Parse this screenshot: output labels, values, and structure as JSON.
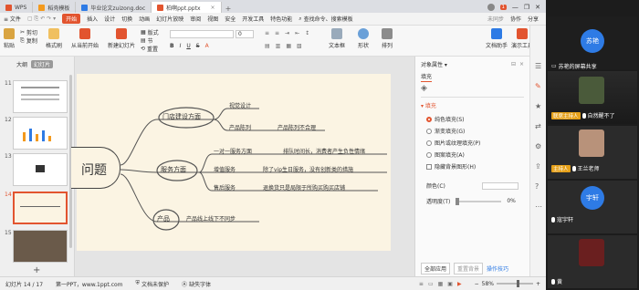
{
  "tabs": [
    {
      "label": "WPS",
      "active": false
    },
    {
      "label": "稻壳模板",
      "active": false
    },
    {
      "label": "毕业论文zuizong.doc",
      "active": false
    },
    {
      "label": "柏啊ppt.pptx",
      "active": true
    }
  ],
  "window": {
    "badge": "1"
  },
  "menu": [
    "≡ 文件",
    "开始",
    "插入",
    "设计",
    "切换",
    "动画",
    "幻灯片放映",
    "审阅",
    "视图",
    "安全",
    "开发工具",
    "特色功能",
    "查找命令、搜索模板",
    "未同步",
    "协作",
    "分享"
  ],
  "menu_active": "开始",
  "ribbon": {
    "paste": "粘贴",
    "cut": "剪切",
    "copy": "复制",
    "format_painter": "格式刷",
    "from_start": "从当前开始",
    "new_slide": "新建幻灯片",
    "layout": "版式",
    "section": "节",
    "reset": "重置",
    "bold": "B",
    "italic": "I",
    "underline": "U",
    "strike": "S",
    "font_size": "0",
    "text_box": "文本框",
    "shape": "形状",
    "arrange": "排列",
    "textbox_label": "文字",
    "find": "文档助手",
    "replace": "演示工具"
  },
  "side_tabs": [
    "大纲",
    "幻灯片"
  ],
  "slides": [
    {
      "num": "11"
    },
    {
      "num": "12"
    },
    {
      "num": "13"
    },
    {
      "num": "14"
    },
    {
      "num": "15"
    }
  ],
  "mindmap": {
    "root": "问题",
    "branches": [
      {
        "label": "门店建设方面",
        "leaves": [
          "视觉设计",
          "产品陈列",
          "产品陈列不合理"
        ]
      },
      {
        "label": "服务方面",
        "leaves": [
          "一对一服务方面",
          "排队时间长，消费者产生负性情绪",
          "增值服务",
          "除了vip生日服务，没有创新类的措施",
          "售后服务",
          "退换货只是局限于所购买购买店铺"
        ]
      },
      {
        "label": "产品",
        "leaves": [
          "产品线上线下不同步"
        ]
      }
    ]
  },
  "taskpane": {
    "title": "对象属性 ▾",
    "tab": "填充",
    "section": "▾ 填充",
    "options": [
      "纯色填充(S)",
      "渐变填充(G)",
      "图片或纹理填充(P)",
      "图案填充(A)",
      "隐藏背景图形(H)"
    ],
    "selected": "纯色填充(S)",
    "color_label": "颜色(C)",
    "transparency_label": "透明度(T)",
    "transparency_value": "0%",
    "apply_all": "全部应用",
    "reset_bg": "重置背景",
    "tips": "操作技巧"
  },
  "status": {
    "slide_count": "幻灯片 14 / 17",
    "theme": "第一PPT，www.1ppt.com",
    "backup": "文档未保护",
    "font_missing": "缺失字体",
    "zoom": "58%"
  },
  "video": {
    "participants": [
      {
        "name": "苏艳的屏幕共享",
        "avatar": "苏艳",
        "type": "avatar"
      },
      {
        "name": "自然醒不了",
        "host": "联席主持人",
        "type": "photo"
      },
      {
        "name": "王兰老师",
        "host": "主持人",
        "type": "photo"
      },
      {
        "name": "寇宇轩",
        "avatar": "宇轩",
        "type": "avatar"
      },
      {
        "name": "黄",
        "type": "photo"
      }
    ]
  },
  "colors": {
    "accent": "#e2542f",
    "avatar": "#2e7be5",
    "host": "#e6a11a",
    "slide_bg": "#fbf4e3"
  }
}
